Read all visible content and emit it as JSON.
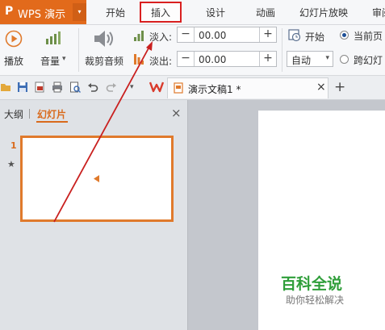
{
  "app": {
    "logo_text": "P",
    "title": "WPS 演示",
    "dropdown_glyph": "▾"
  },
  "menu_tabs": [
    {
      "label": "开始"
    },
    {
      "label": "插入"
    },
    {
      "label": "设计"
    },
    {
      "label": "动画"
    },
    {
      "label": "幻灯片放映"
    },
    {
      "label": "审阅"
    }
  ],
  "ribbon": {
    "play_label": "播放",
    "volume_label": "音量",
    "volume_arrow": "▾",
    "trim_label": "裁剪音频",
    "fade_in_label": "淡入:",
    "fade_out_label": "淡出:",
    "fade_in_value": "00.00",
    "fade_out_value": "00.00",
    "minus": "−",
    "plus": "+",
    "start_label": "开始",
    "start_select_value": "自动",
    "select_arrow": "▾",
    "radio_current_label": "当前页",
    "radio_cross_label": "跨幻灯"
  },
  "qat": {
    "doc_tab_title": "演示文稿1 *",
    "close_glyph": "×",
    "new_tab_glyph": "+"
  },
  "left_panel": {
    "tab_outline": "大纲",
    "tab_slides": "幻灯片",
    "close_glyph": "×",
    "slide_number": "1",
    "star_glyph": "★"
  },
  "watermark": {
    "title": "百科全说",
    "subtitle": "助你轻松解决"
  },
  "colors": {
    "brand": "#e26a1b",
    "annotation": "#d92020",
    "accent_tab": "#d96a1c",
    "watermark_green": "#2f9e3a"
  }
}
